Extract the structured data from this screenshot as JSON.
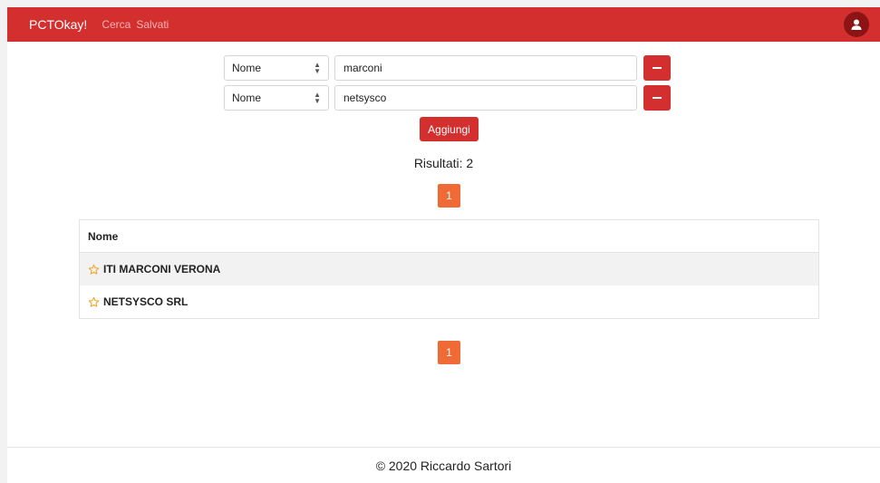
{
  "navbar": {
    "brand": "PCTOkay!",
    "links": [
      "Cerca",
      "Salvati"
    ],
    "avatar_icon": "user-icon"
  },
  "filters": [
    {
      "field": "Nome",
      "value": "marconi"
    },
    {
      "field": "Nome",
      "value": "netsysco"
    }
  ],
  "add_label": "Aggiungi",
  "results_label": "Risultati: 2",
  "pagination": {
    "current": "1"
  },
  "table": {
    "header": "Nome",
    "rows": [
      {
        "name": "ITI MARCONI VERONA",
        "icon": "star-outline-icon"
      },
      {
        "name": "NETSYSCO SRL",
        "icon": "star-outline-icon"
      }
    ]
  },
  "footer": "© 2020 Riccardo Sartori",
  "colors": {
    "primary": "#d32f2f",
    "page_button": "#f06a35",
    "star": "#f0a830"
  }
}
